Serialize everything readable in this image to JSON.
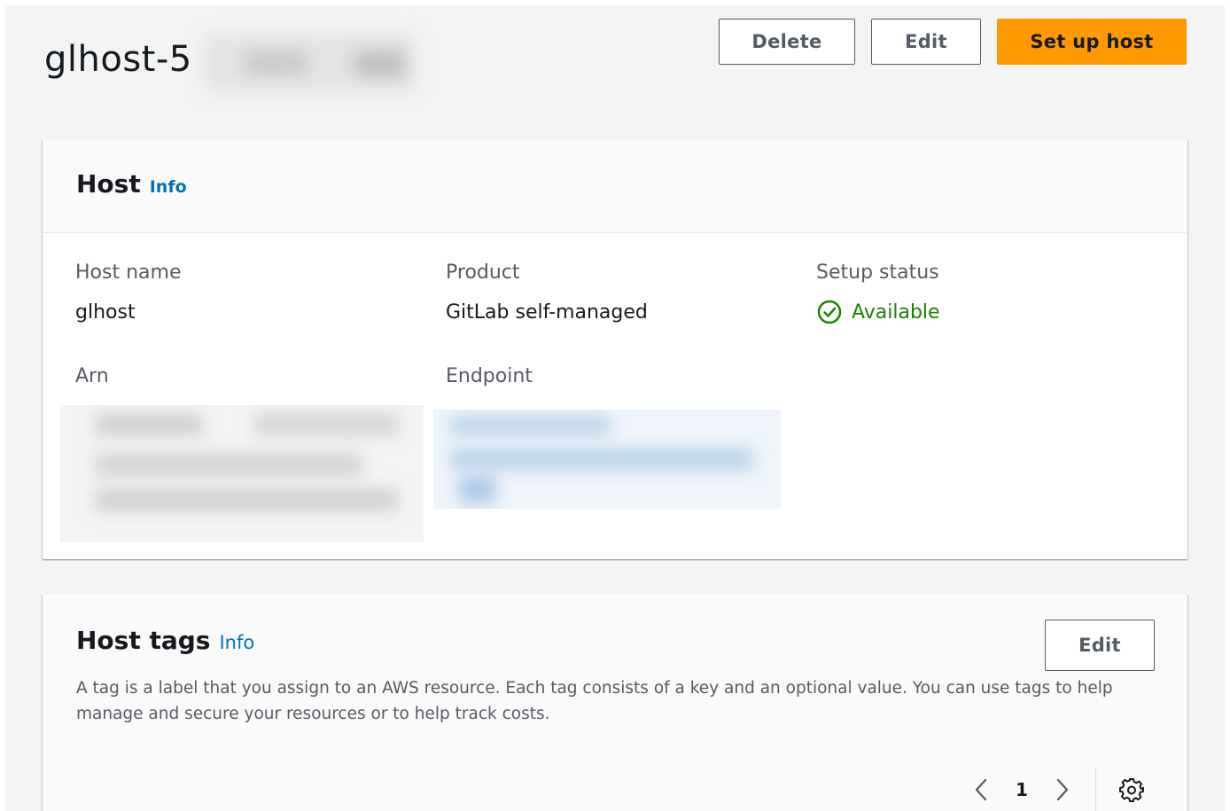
{
  "page": {
    "title": "glhost-5"
  },
  "actions": {
    "delete_label": "Delete",
    "edit_label": "Edit",
    "setup_label": "Set up host"
  },
  "host_card": {
    "title": "Host",
    "info_label": "Info",
    "host_name": {
      "label": "Host name",
      "value": "glhost"
    },
    "product": {
      "label": "Product",
      "value": "GitLab self-managed"
    },
    "setup_status": {
      "label": "Setup status",
      "value": "Available",
      "color": "#1d8102",
      "icon": "status-available-icon"
    },
    "arn": {
      "label": "Arn"
    },
    "endpoint": {
      "label": "Endpoint"
    }
  },
  "tags_card": {
    "title": "Host tags",
    "info_label": "Info",
    "edit_label": "Edit",
    "description": "A tag is a label that you assign to an AWS resource. Each tag consists of a key and an optional value. You can use tags to help manage and secure your resources or to help track costs.",
    "pagination": {
      "current_page": "1"
    }
  },
  "colors": {
    "accent": "#ff9900",
    "link": "#0073bb",
    "background": "#f2f3f3"
  }
}
